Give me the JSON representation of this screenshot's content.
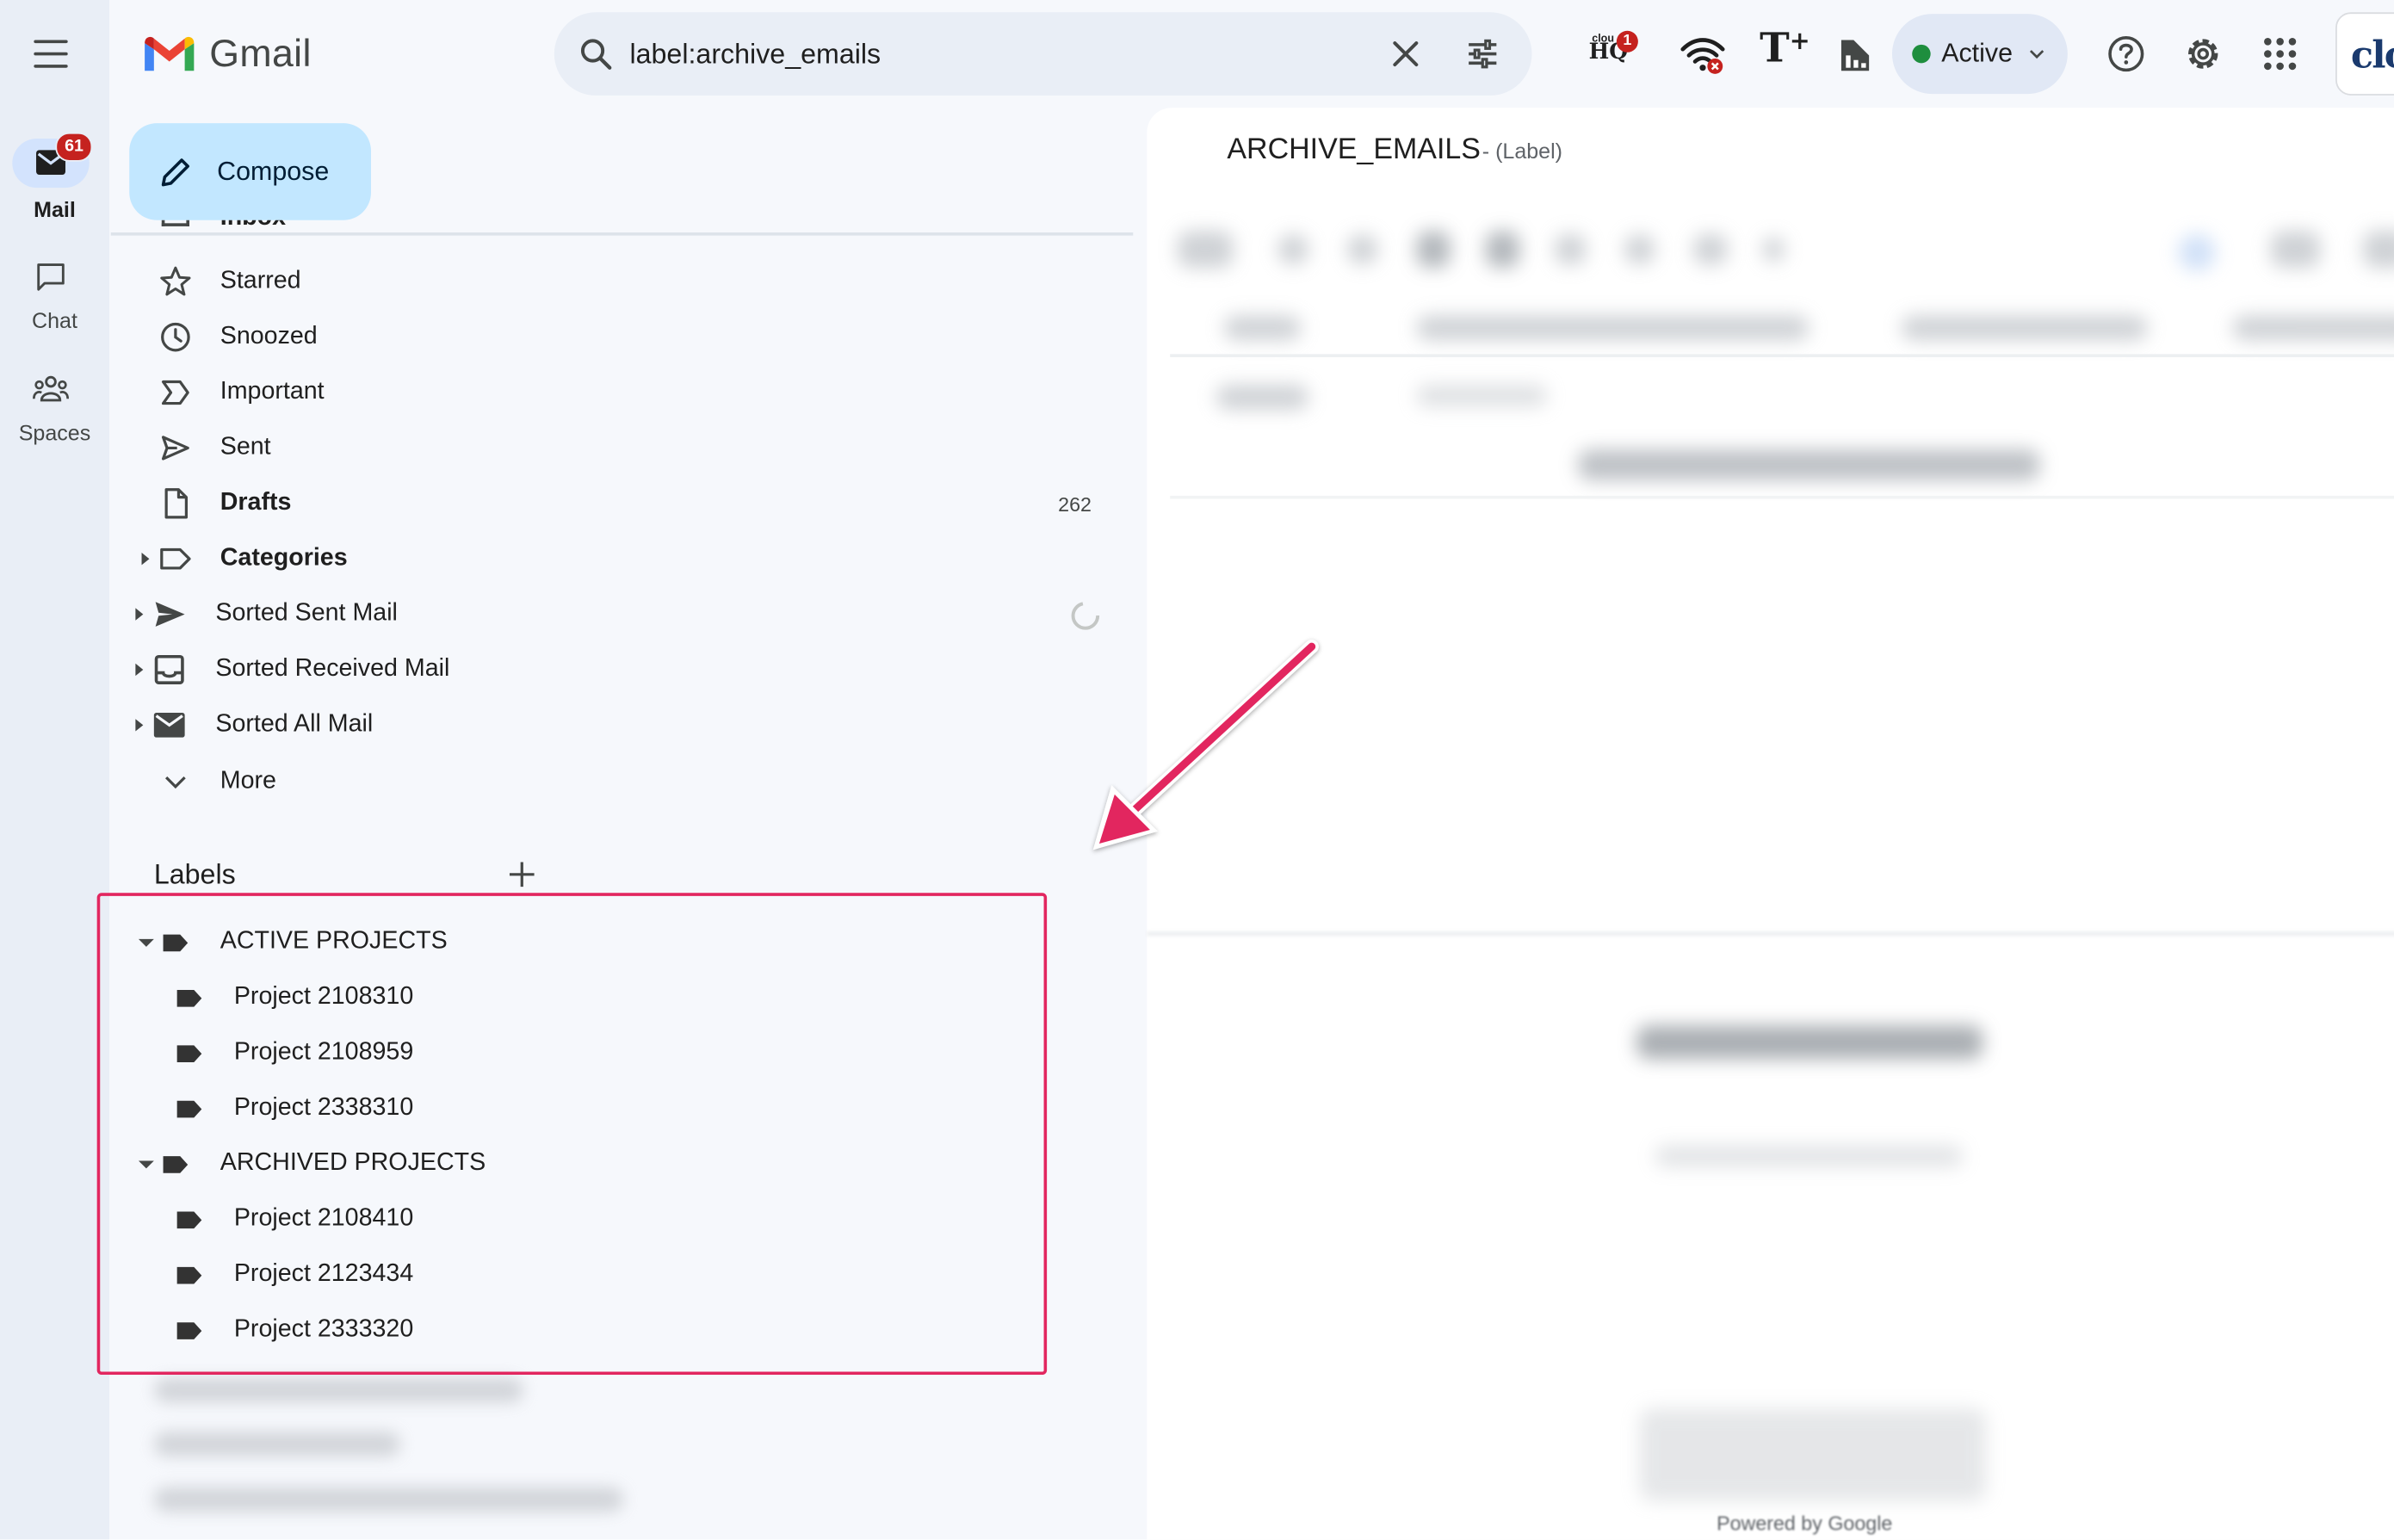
{
  "app": {
    "name": "Gmail",
    "colors": {
      "accent": "#0b57d0",
      "compose_bg": "#c2e7ff",
      "highlight": "#e2265f",
      "badge": "#c5221f",
      "active_dot": "#1e8e3e"
    }
  },
  "rail": {
    "items": [
      {
        "label": "Mail",
        "icon": "mail-icon",
        "badge": "61"
      },
      {
        "label": "Chat",
        "icon": "chat-icon"
      },
      {
        "label": "Spaces",
        "icon": "spaces-icon"
      }
    ]
  },
  "search": {
    "value": "label:archive_emails"
  },
  "header": {
    "status_label": "Active",
    "extension_badge": "1",
    "account_text": "clo"
  },
  "compose": {
    "label": "Compose"
  },
  "nav": {
    "partial_item": "Inbox",
    "items": [
      {
        "label": "Starred",
        "icon": "star-icon"
      },
      {
        "label": "Snoozed",
        "icon": "clock-icon"
      },
      {
        "label": "Important",
        "icon": "important-icon"
      },
      {
        "label": "Sent",
        "icon": "send-icon"
      },
      {
        "label": "Drafts",
        "icon": "draft-icon",
        "count": "262",
        "bold": true
      },
      {
        "label": "Categories",
        "icon": "label-outline-icon",
        "bold": true
      },
      {
        "label": "Sorted Sent Mail",
        "icon": "send-filled-icon"
      },
      {
        "label": "Sorted Received Mail",
        "icon": "inbox-icon"
      },
      {
        "label": "Sorted All Mail",
        "icon": "mail-filled-icon"
      },
      {
        "label": "More",
        "icon": "chevron-down-icon"
      }
    ]
  },
  "labels": {
    "heading": "Labels",
    "groups": [
      {
        "name": "ACTIVE PROJECTS",
        "children": [
          "Project 2108310",
          "Project 2108959",
          "Project 2338310"
        ]
      },
      {
        "name": "ARCHIVED PROJECTS",
        "children": [
          "Project 2108410",
          "Project 2123434",
          "Project 2333320"
        ]
      }
    ]
  },
  "main": {
    "title": "ARCHIVE_EMAILS",
    "subtitle": "- (Label)",
    "footer": "Powered by Google"
  }
}
